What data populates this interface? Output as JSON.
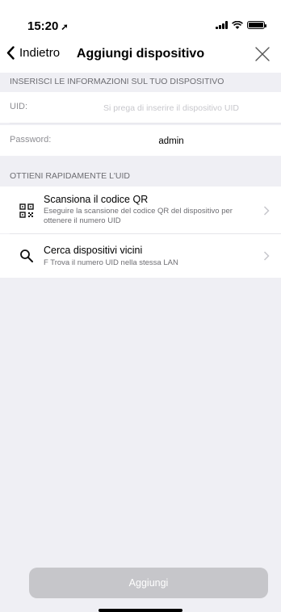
{
  "status_bar": {
    "time": "15:20",
    "location_arrow": "➚"
  },
  "nav": {
    "back_label": "Indietro",
    "title": "Aggiungi dispositivo"
  },
  "section1": {
    "title": "INSERISCI LE INFORMAZIONI SUL TUO DISPOSITIVO"
  },
  "fields": {
    "uid": {
      "label": "UID:",
      "value": "",
      "placeholder": "Si prega di inserire il dispositivo UID"
    },
    "password": {
      "label": "Password:",
      "value": "admin"
    }
  },
  "section2": {
    "title": "OTTIENI RAPIDAMENTE L'UID"
  },
  "items": [
    {
      "icon": "qr-code-icon",
      "title": "Scansiona il codice QR",
      "description": "Eseguire la scansione del codice QR del dispositivo per ottenere il numero UID"
    },
    {
      "icon": "search-icon",
      "title": "Cerca dispositivi vicini",
      "description": "F Trova il numero UID nella stessa LAN"
    }
  ],
  "add_button": {
    "label": "Aggiungi"
  },
  "colors": {
    "background": "#efeff4",
    "button_disabled": "#c6c6ca",
    "secondary_text": "#8e8e93"
  }
}
